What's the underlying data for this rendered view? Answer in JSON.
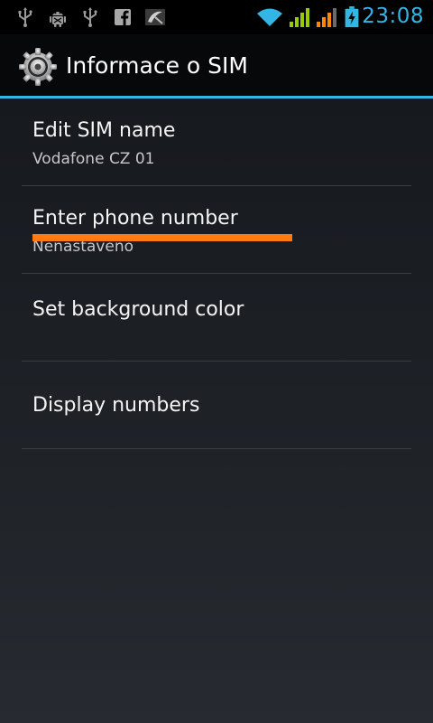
{
  "status_bar": {
    "time": "23:08",
    "left_icons": [
      "usb-icon",
      "android-debug-icon",
      "usb-icon",
      "facebook-icon",
      "app-notification-icon"
    ],
    "right_icons": [
      "wifi-icon",
      "signal-icon",
      "signal-roaming-icon",
      "battery-charging-icon"
    ]
  },
  "action_bar": {
    "title": "Informace o SIM",
    "icon": "settings-gear-icon"
  },
  "preferences": [
    {
      "title": "Edit SIM name",
      "summary": "Vodafone CZ 01"
    },
    {
      "title": "Enter phone number",
      "summary": "Nenastaveno"
    },
    {
      "title": "Set background color",
      "color": "#ff7a12"
    },
    {
      "title": "Display numbers"
    }
  ],
  "colors": {
    "accent": "#33b5e5",
    "sim_color": "#ff7a12"
  }
}
